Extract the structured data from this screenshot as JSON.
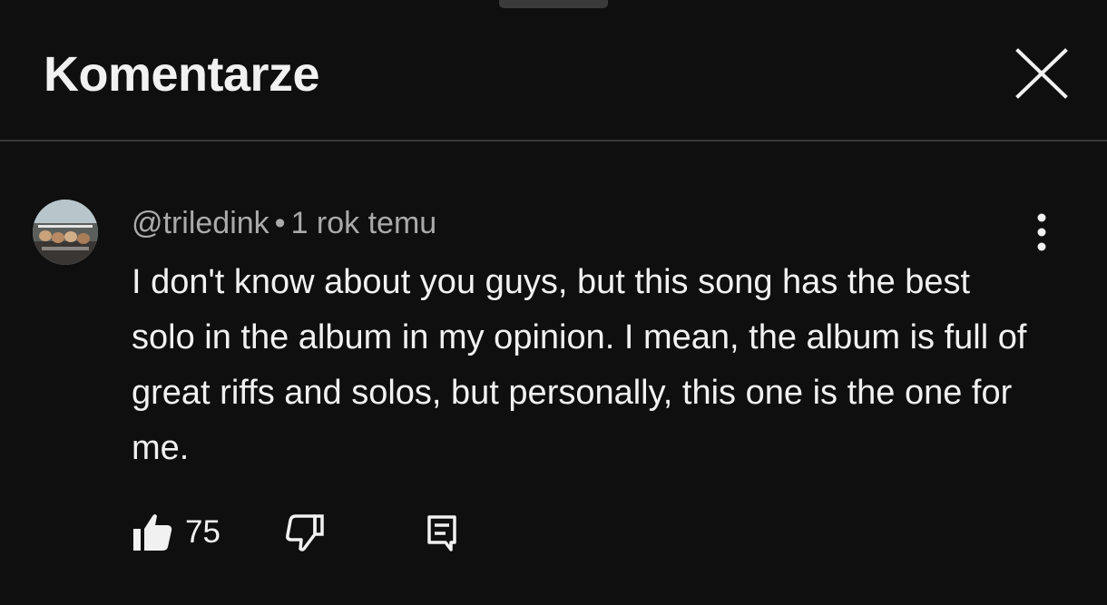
{
  "header": {
    "title": "Komentarze"
  },
  "comment": {
    "author": "@triledink",
    "separator": "•",
    "time": "1 rok temu",
    "text": "I don't know about you guys, but this song has the best solo in the album in my opinion. I mean, the album is full of great riffs and solos, but personally, this one is the one for me.",
    "likes": "75"
  },
  "icons": {
    "close": "close-icon",
    "more": "more-vert-icon",
    "like": "thumbs-up-filled-icon",
    "dislike": "thumbs-down-outline-icon",
    "reply": "reply-comment-icon"
  },
  "colors": {
    "background": "#0f0f0f",
    "text": "#f1f1f1",
    "secondary_text": "#aaaaaa",
    "divider": "#3a3a3a"
  }
}
